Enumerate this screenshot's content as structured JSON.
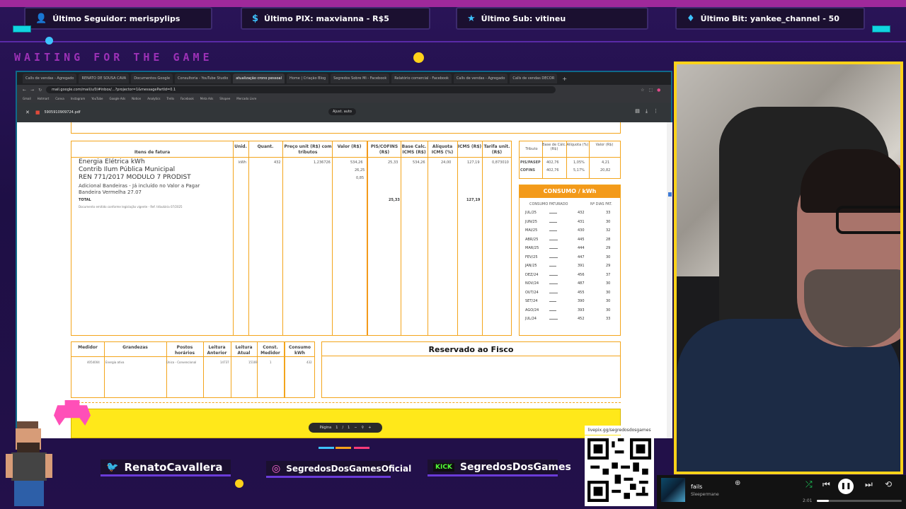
{
  "overlay": {
    "alerts": [
      {
        "label": "Último Seguidor: merispylips",
        "icon": "user-icon"
      },
      {
        "label": "Último PIX: maxvianna - R$5",
        "icon": "dollar-icon"
      },
      {
        "label": "Último Sub: vitineu",
        "icon": "star-icon"
      },
      {
        "label": "Último Bit: yankee_channel - 50",
        "icon": "diamond-icon"
      }
    ],
    "waiting_text": "WAITING FOR THE GAME",
    "socials": {
      "twitter": "RenatoCavallera",
      "instagram": "SegredosDosGamesOficial",
      "kick_badge": "KICK",
      "kick": "SegredosDosGames"
    },
    "qr_label": "livepix.gg/segredosdosgames",
    "accent_colors": {
      "neon_pink": "#ff3bd4",
      "teal": "#10d5e0",
      "yellow": "#ffd21a",
      "purple": "#2a1458"
    }
  },
  "browser": {
    "tabs": [
      "Calls de vendas - Agregado",
      "RENATO DE SOUSA CAVA",
      "Documentos Google",
      "Consultoria - YouTube Studio",
      "atualização crono pessoal",
      "Home | Criação Blog",
      "Segredos Sobre Mi - Facebook",
      "Relatório comercial - Facebook",
      "Calls de vendas - Agregado",
      "Calls de vendas DECOR"
    ],
    "url": "mail.google.com/mail/u/0/#inbox/...?projector=1&messagePartId=0.1",
    "bookmarks": [
      "Gmail",
      "Hotmart",
      "Canva",
      "Instagram",
      "YouTube",
      "Google Ads",
      "Notion",
      "Analytics",
      "Trello",
      "Facebook",
      "Meta Ads",
      "Shopee",
      "Mercado Livre"
    ],
    "pdf": {
      "filename": "5905910909724.pdf",
      "zoom": "Ajust. auto",
      "page_nav": {
        "label": "Página",
        "current": "1",
        "sep": "/",
        "total": "1"
      }
    }
  },
  "invoice": {
    "item_headers": [
      "Itens de fatura",
      "Unid.",
      "Quant.",
      "Preço unit (R$) com tributos",
      "Valor (R$)",
      "PIS/COFINS (R$)",
      "Base Calc. ICMS (R$)",
      "Alíquota ICMS (%)",
      "ICMS (R$)",
      "Tarifa unit. (R$)"
    ],
    "items": [
      {
        "desc": "Energia Elétrica kWh",
        "unid": "kWh",
        "quant": "432",
        "preco": "1,236726",
        "valor": "534,26",
        "pis": "25,33",
        "base": "534,26",
        "aliq": "24,00",
        "icms": "127,19",
        "tarifa": "0,873010"
      },
      {
        "desc": "Contrib Ilum Pública Municipal",
        "valor": "26,25"
      },
      {
        "desc": "REN 771/2017 MODULO 7 PRODIST",
        "valor": "0,85"
      },
      {
        "desc": "Adicional Bandeiras - Já incluído no Valor a Pagar"
      },
      {
        "desc": "Bandeira Vermelha 27.07"
      }
    ],
    "total_label": "TOTAL",
    "total_pis": "25,33",
    "total_icms": "127,19",
    "footnote": "Documento emitido conforme legislação vigente - Ref. tributária 07/2025",
    "tributo": {
      "headers": [
        "Tributo",
        "Base de Cálc. (R$)",
        "Alíquota (%)",
        "Valor (R$)"
      ],
      "rows": [
        {
          "name": "PIS/PASEP",
          "base": "402,76",
          "aliq": "1,05%",
          "valor": "4,21"
        },
        {
          "name": "COFINS",
          "base": "402,76",
          "aliq": "5,17%",
          "valor": "20,82"
        }
      ]
    },
    "consumo": {
      "title": "CONSUMO / kWh",
      "headers": [
        "CONSUMO FATURADO",
        "Nº DIAS FAT."
      ],
      "rows": [
        {
          "mes": "JUL/25",
          "kwh": "432",
          "dias": "33",
          "v": 0.95
        },
        {
          "mes": "JUN/25",
          "kwh": "431",
          "dias": "30",
          "v": 0.94
        },
        {
          "mes": "MAI/25",
          "kwh": "430",
          "dias": "32",
          "v": 0.94
        },
        {
          "mes": "ABR/25",
          "kwh": "445",
          "dias": "28",
          "v": 0.97
        },
        {
          "mes": "MAR/25",
          "kwh": "444",
          "dias": "29",
          "v": 0.97
        },
        {
          "mes": "FEV/25",
          "kwh": "447",
          "dias": "30",
          "v": 0.98
        },
        {
          "mes": "JAN/25",
          "kwh": "391",
          "dias": "29",
          "v": 0.85
        },
        {
          "mes": "DEZ/24",
          "kwh": "456",
          "dias": "37",
          "v": 1.0
        },
        {
          "mes": "NOV/24",
          "kwh": "487",
          "dias": "30",
          "v": 1.0
        },
        {
          "mes": "OUT/24",
          "kwh": "455",
          "dias": "30",
          "v": 1.0
        },
        {
          "mes": "SET/24",
          "kwh": "390",
          "dias": "30",
          "v": 0.85
        },
        {
          "mes": "AGO/24",
          "kwh": "393",
          "dias": "30",
          "v": 0.86
        },
        {
          "mes": "JUL/24",
          "kwh": "452",
          "dias": "33",
          "v": 0.99
        }
      ]
    },
    "medidor": {
      "headers": [
        "Medidor",
        "Grandezas",
        "Postos horários",
        "Leitura Anterior",
        "Leitura Atual",
        "Const. Medidor",
        "Consumo kWh"
      ],
      "row": [
        "4054004",
        "Energia ativa",
        "Único - Convencional",
        "14737",
        "15169",
        "1",
        "432"
      ]
    },
    "fisco_title": "Reservado ao Fisco"
  },
  "player": {
    "track": "fails",
    "artist": "Sleepermane",
    "time": "2:01",
    "progress": 0.14
  }
}
